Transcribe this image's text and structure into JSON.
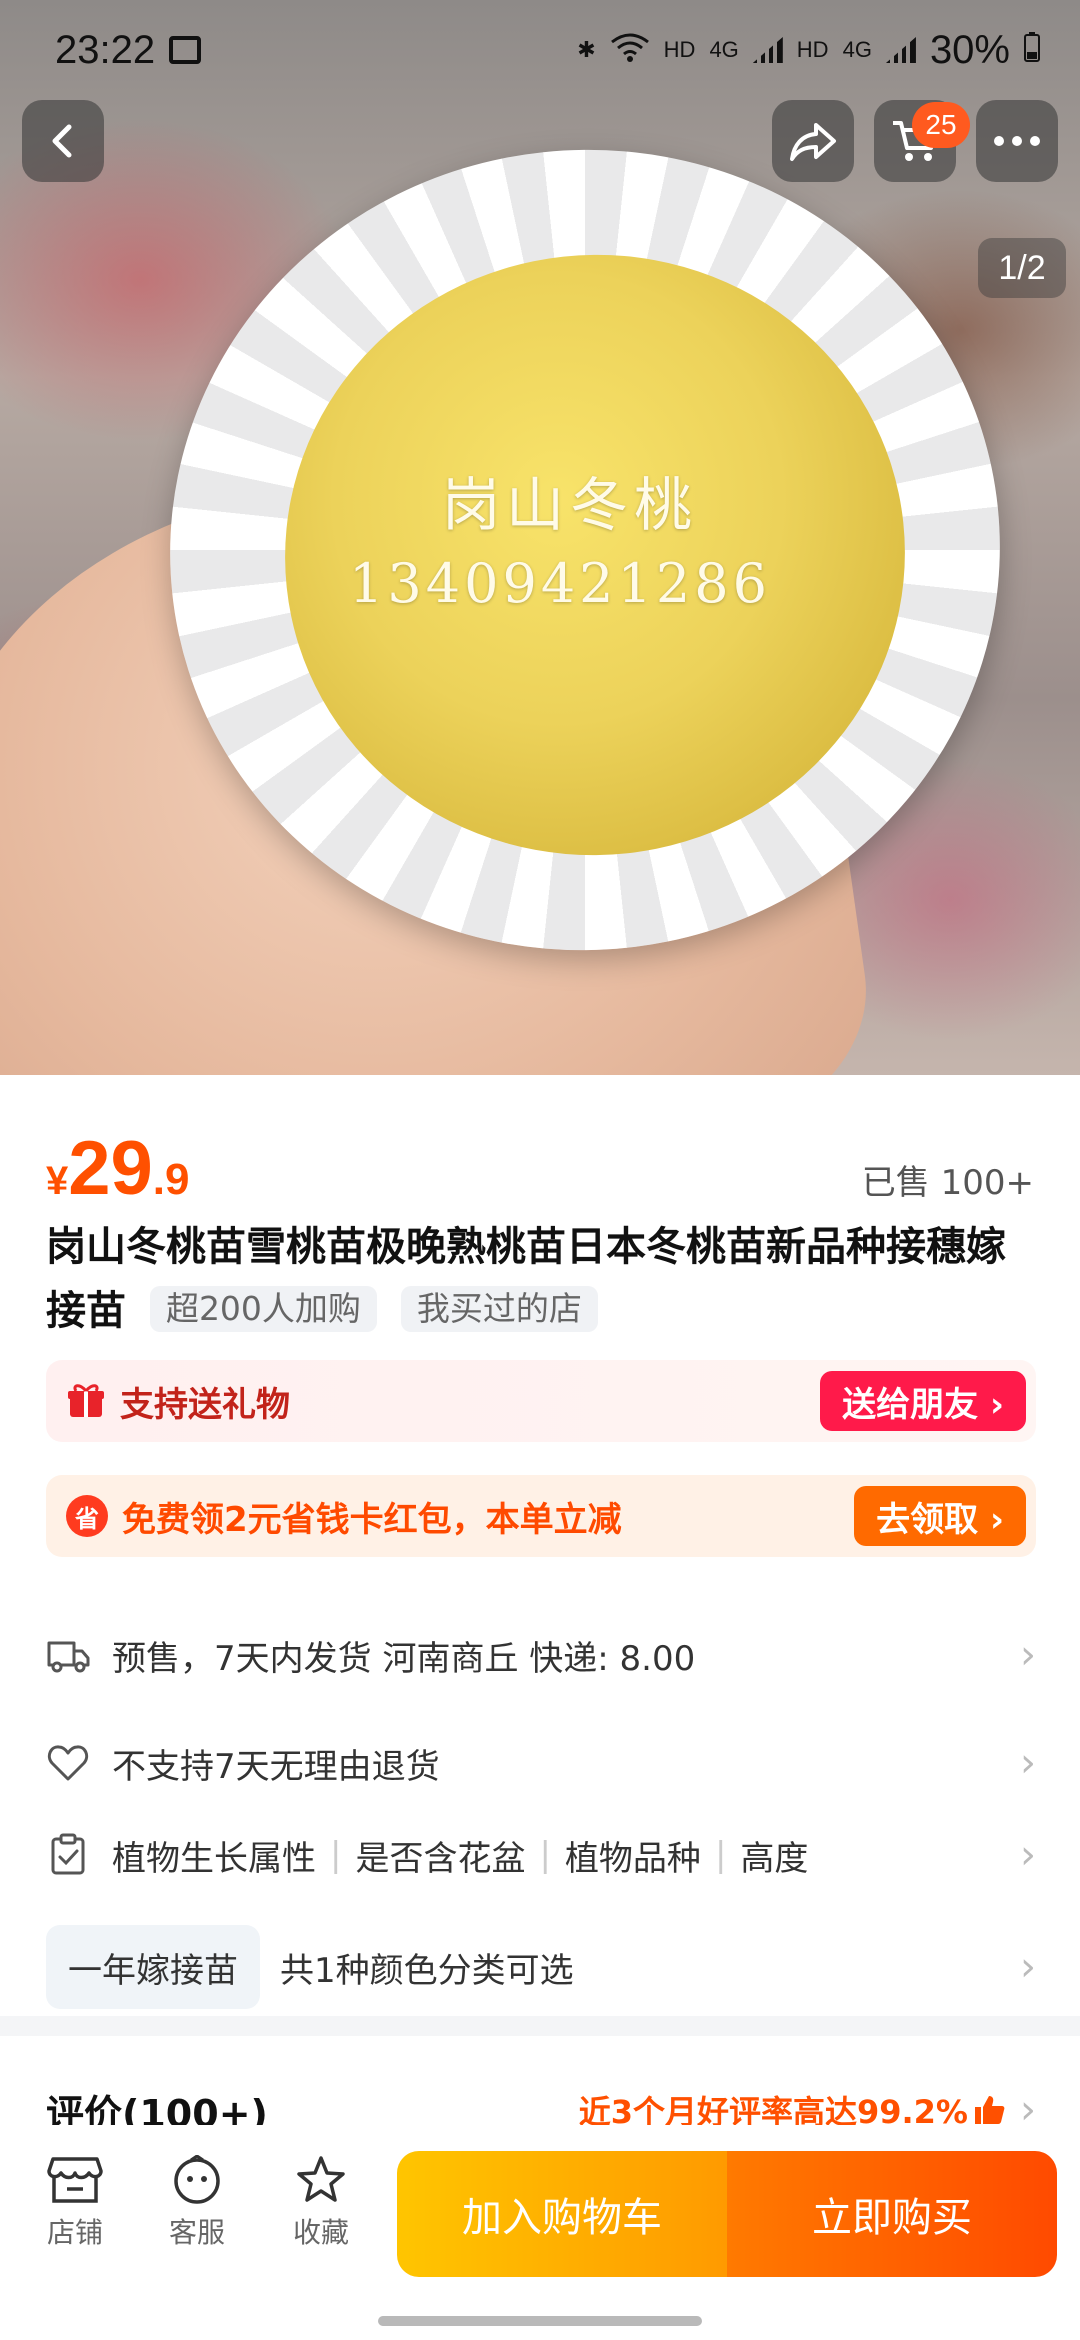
{
  "status_bar": {
    "time": "23:22",
    "hd1": "HD",
    "net1": "4G",
    "hd2": "HD",
    "net2": "4G",
    "battery": "30%"
  },
  "header": {
    "cart_count": "25",
    "image_pager": "1/2"
  },
  "image": {
    "watermark_line1": "岗山冬桃",
    "watermark_line2": "13409421286"
  },
  "price": {
    "symbol": "¥",
    "integer": "29",
    "decimal": ".9",
    "sold": "已售 100+"
  },
  "product": {
    "title": "岗山冬桃苗雪桃苗极晚熟桃苗日本冬桃苗新品种接穗嫁接苗",
    "tags": [
      "超200人加购",
      "我买过的店"
    ]
  },
  "gift": {
    "text": "支持送礼物",
    "button": "送给朋友 ›"
  },
  "coupon": {
    "icon": "省",
    "text": "免费领2元省钱卡红包，本单立减",
    "button": "去领取 ›"
  },
  "shipping": {
    "text": "预售，7天内发货  河南商丘  快递: 8.00"
  },
  "returns": {
    "text": "不支持7天无理由退货"
  },
  "attributes": {
    "items": [
      "植物生长属性",
      "是否含花盆",
      "植物品种",
      "高度"
    ]
  },
  "variant": {
    "chip": "一年嫁接苗",
    "text": "共1种颜色分类可选"
  },
  "reviews": {
    "label": "评价(100+)",
    "rate": "近3个月好评率高达99.2%"
  },
  "bottom_bar": {
    "shop": "店铺",
    "service": "客服",
    "favorite": "收藏",
    "add_to_cart": "加入购物车",
    "buy_now": "立即购买"
  },
  "colors": {
    "accent": "#ff5000",
    "gift_red": "#ff1a4a",
    "coupon_orange": "#ff6a00"
  }
}
